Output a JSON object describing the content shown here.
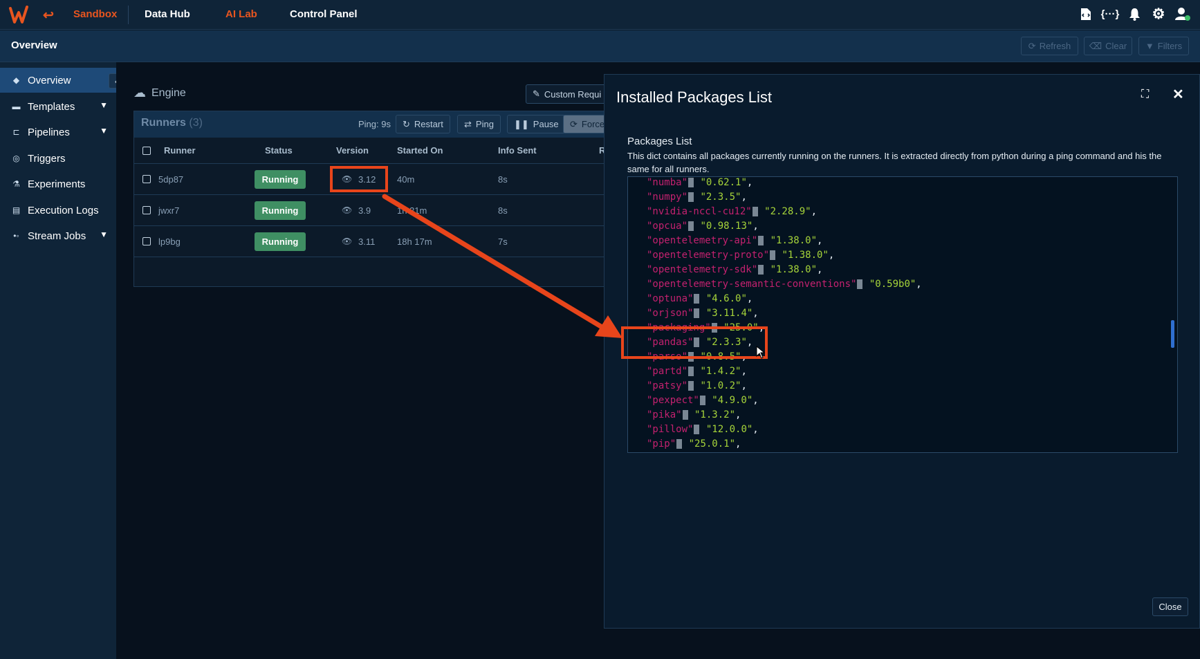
{
  "topnav": {
    "items": [
      {
        "label": "Sandbox",
        "color": "#e8551f"
      },
      {
        "label": "Data Hub",
        "color": "#ffffff"
      },
      {
        "label": "AI Lab",
        "color": "#e8551f"
      },
      {
        "label": "Control Panel",
        "color": "#ffffff"
      }
    ],
    "icons": [
      "file-code-icon",
      "braces-icon",
      "bell-icon",
      "gear-icon",
      "user-icon"
    ]
  },
  "pagebar": {
    "title": "Overview",
    "buttons": [
      "Refresh",
      "Clear",
      "Filters"
    ]
  },
  "sidebar": {
    "items": [
      {
        "label": "Overview",
        "icon": "overview-icon",
        "active": true,
        "expandable": false
      },
      {
        "label": "Templates",
        "icon": "templates-icon",
        "active": false,
        "expandable": true
      },
      {
        "label": "Pipelines",
        "icon": "pipelines-icon",
        "active": false,
        "expandable": true
      },
      {
        "label": "Triggers",
        "icon": "triggers-icon",
        "active": false,
        "expandable": false
      },
      {
        "label": "Experiments",
        "icon": "flask-icon",
        "active": false,
        "expandable": false
      },
      {
        "label": "Execution Logs",
        "icon": "logs-icon",
        "active": false,
        "expandable": false
      },
      {
        "label": "Stream Jobs",
        "icon": "stream-icon",
        "active": false,
        "expandable": true
      }
    ]
  },
  "engine": {
    "title": "Engine",
    "custom_requirements_label": "Custom Requi"
  },
  "runners": {
    "title": "Runners",
    "count": "(3)",
    "ping": "Ping: 9s",
    "buttons": {
      "restart": "Restart",
      "ping": "Ping",
      "pause": "Pause",
      "force": "Force"
    },
    "columns": [
      "Runner",
      "Status",
      "Version",
      "Started On",
      "Info Sent",
      "R"
    ],
    "rows": [
      {
        "runner": "5dp87",
        "status": "Running",
        "version": "3.12",
        "started": "40m",
        "info": "8s"
      },
      {
        "runner": "jwxr7",
        "status": "Running",
        "version": "3.9",
        "started": "1h 31m",
        "info": "8s"
      },
      {
        "runner": "lp9bg",
        "status": "Running",
        "version": "3.11",
        "started": "18h 17m",
        "info": "7s"
      }
    ]
  },
  "modal": {
    "title": "Installed Packages List",
    "packages_label": "Packages List",
    "description": "This dict contains all packages currently running on the runners. It is extracted directly from python during a ping command and his the same for all runners.",
    "close_label": "Close",
    "packages": [
      {
        "name": "numba",
        "version": "0.62.1"
      },
      {
        "name": "numpy",
        "version": "2.3.5"
      },
      {
        "name": "nvidia-nccl-cu12",
        "version": "2.28.9"
      },
      {
        "name": "opcua",
        "version": "0.98.13"
      },
      {
        "name": "opentelemetry-api",
        "version": "1.38.0"
      },
      {
        "name": "opentelemetry-proto",
        "version": "1.38.0"
      },
      {
        "name": "opentelemetry-sdk",
        "version": "1.38.0"
      },
      {
        "name": "opentelemetry-semantic-conventions",
        "version": "0.59b0"
      },
      {
        "name": "optuna",
        "version": "4.6.0"
      },
      {
        "name": "orjson",
        "version": "3.11.4"
      },
      {
        "name": "packaging",
        "version": "25.0"
      },
      {
        "name": "pandas",
        "version": "2.3.3"
      },
      {
        "name": "parso",
        "version": "0.8.5"
      },
      {
        "name": "partd",
        "version": "1.4.2"
      },
      {
        "name": "patsy",
        "version": "1.0.2"
      },
      {
        "name": "pexpect",
        "version": "4.9.0"
      },
      {
        "name": "pika",
        "version": "1.3.2"
      },
      {
        "name": "pillow",
        "version": "12.0.0"
      },
      {
        "name": "pip",
        "version": "25.0.1"
      }
    ]
  },
  "annotation_color": "#e8451b"
}
